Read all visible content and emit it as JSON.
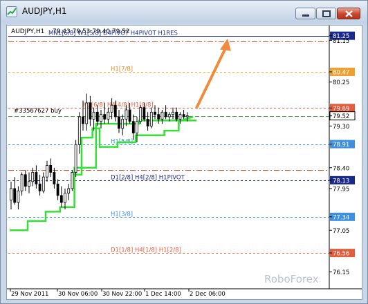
{
  "window": {
    "title": "AUDJPY,H1",
    "buttons": [
      "minimize",
      "maximize",
      "close"
    ]
  },
  "chart_header": {
    "symbol": "AUDJPY,H1",
    "ohlc": "79.43 79.53 79.40 79.52"
  },
  "watermark": "RoboForex",
  "levels": [
    {
      "label": "MN1[6/8] W1[5/8] D4PIVOT H4PIVOT H1RES",
      "price": 81.25,
      "color": "#1a2a8c",
      "style": "solid",
      "label_color": "#1a2a8c"
    },
    {
      "label": "",
      "price": 81.13,
      "color": "#d9442b",
      "style": "dashdot",
      "label_color": ""
    },
    {
      "label": "H1[7/8]",
      "price": 80.47,
      "color": "#f0a030",
      "style": "dash",
      "label_color": "#e08a20"
    },
    {
      "label": "H1[6/8] H4[4/8] H1[8/8]",
      "price": 79.69,
      "color": "#e35c3e",
      "style": "dash",
      "label_color": "#e35c3e"
    },
    {
      "label": "H1[5/8]",
      "price": 78.91,
      "color": "#3d8fe0",
      "style": "dash",
      "label_color": "#3d8fe0"
    },
    {
      "label": "",
      "price": 78.35,
      "color": "#d9442b",
      "style": "dashdot",
      "label_color": ""
    },
    {
      "label": "D1[2/8] H4[2/8] H1PIVOT",
      "price": 78.13,
      "color": "#1a2a8c",
      "style": "dash",
      "label_color": "#1a2a8c"
    },
    {
      "label": "H1[3/8]",
      "price": 77.34,
      "color": "#3d8fe0",
      "style": "dash",
      "label_color": "#3d8fe0"
    },
    {
      "label": "D1[1/8] H4[1/8] H1[2/8]",
      "price": 76.56,
      "color": "#e35c3e",
      "style": "dash",
      "label_color": "#e35c3e"
    }
  ],
  "order": {
    "label": "#33567627 buy",
    "price": 79.52,
    "color": "#3c9a3c"
  },
  "current_price": {
    "value": 79.52,
    "color": "#000000"
  },
  "price_labels": [
    {
      "text": "81.25",
      "price": 81.25,
      "bg": "#1a2a8c",
      "fg": "#ffffff"
    },
    {
      "text": "81.15",
      "price": 81.15,
      "bg": "",
      "fg": "#000000"
    },
    {
      "text": "80.47",
      "price": 80.47,
      "bg": "#f0a030",
      "fg": "#ffffff"
    },
    {
      "text": "80.25",
      "price": 80.25,
      "bg": "",
      "fg": "#000000"
    },
    {
      "text": "79.69",
      "price": 79.69,
      "bg": "#e35c3e",
      "fg": "#ffffff"
    },
    {
      "text": "79.52",
      "price": 79.52,
      "bg": "#ffffff",
      "fg": "#000000"
    },
    {
      "text": "79.30",
      "price": 79.3,
      "bg": "",
      "fg": "#000000"
    },
    {
      "text": "78.91",
      "price": 78.91,
      "bg": "#3d8fe0",
      "fg": "#ffffff"
    },
    {
      "text": "78.40",
      "price": 78.4,
      "bg": "",
      "fg": "#000000"
    },
    {
      "text": "78.13",
      "price": 78.13,
      "bg": "#1a2a8c",
      "fg": "#ffffff"
    },
    {
      "text": "77.95",
      "price": 77.95,
      "bg": "",
      "fg": "#000000"
    },
    {
      "text": "77.34",
      "price": 77.34,
      "bg": "#3d8fe0",
      "fg": "#ffffff"
    },
    {
      "text": "77.05",
      "price": 77.05,
      "bg": "",
      "fg": "#000000"
    },
    {
      "text": "76.56",
      "price": 76.56,
      "bg": "#e35c3e",
      "fg": "#ffffff"
    },
    {
      "text": "76.15",
      "price": 76.15,
      "bg": "",
      "fg": "#000000"
    }
  ],
  "time_labels": [
    "29 Nov 2011",
    "30 Nov 06:00",
    "30 Nov 22:00",
    "1 Dec 14:00",
    "2 Dec 06:00"
  ],
  "chart_data": {
    "type": "candlestick",
    "ylim": [
      75.95,
      81.35
    ],
    "candles": [
      [
        77.7,
        78.1,
        77.5,
        77.95
      ],
      [
        77.95,
        78.2,
        77.6,
        77.65
      ],
      [
        77.65,
        78.0,
        77.5,
        77.9
      ],
      [
        77.9,
        78.3,
        77.8,
        78.25
      ],
      [
        78.25,
        78.35,
        77.9,
        78.0
      ],
      [
        78.0,
        78.3,
        77.85,
        78.1
      ],
      [
        78.1,
        78.4,
        78.0,
        78.3
      ],
      [
        78.3,
        78.45,
        77.95,
        78.05
      ],
      [
        78.05,
        78.25,
        77.8,
        77.9
      ],
      [
        77.9,
        78.3,
        77.85,
        78.2
      ],
      [
        78.2,
        78.55,
        78.1,
        78.45
      ],
      [
        78.45,
        78.6,
        78.2,
        78.3
      ],
      [
        78.3,
        78.4,
        77.95,
        78.05
      ],
      [
        78.05,
        78.15,
        77.7,
        77.8
      ],
      [
        77.8,
        78.0,
        77.55,
        77.65
      ],
      [
        77.65,
        77.95,
        77.5,
        77.85
      ],
      [
        77.85,
        78.05,
        77.7,
        77.95
      ],
      [
        77.95,
        78.35,
        77.9,
        78.3
      ],
      [
        78.3,
        79.0,
        78.2,
        78.9
      ],
      [
        78.9,
        79.6,
        78.7,
        79.5
      ],
      [
        79.5,
        79.85,
        79.2,
        79.35
      ],
      [
        79.35,
        80.0,
        79.2,
        79.8
      ],
      [
        79.8,
        79.95,
        79.3,
        79.45
      ],
      [
        79.45,
        79.7,
        79.2,
        79.6
      ],
      [
        79.6,
        79.75,
        79.3,
        79.4
      ],
      [
        79.4,
        79.65,
        79.25,
        79.55
      ],
      [
        79.55,
        79.8,
        79.35,
        79.45
      ],
      [
        79.45,
        79.7,
        79.35,
        79.6
      ],
      [
        79.6,
        79.9,
        79.45,
        79.75
      ],
      [
        79.75,
        79.85,
        79.4,
        79.5
      ],
      [
        79.5,
        79.65,
        79.15,
        79.25
      ],
      [
        79.25,
        79.55,
        79.1,
        79.45
      ],
      [
        79.45,
        79.75,
        79.3,
        79.65
      ],
      [
        79.65,
        79.8,
        79.35,
        79.4
      ],
      [
        79.4,
        79.55,
        79.0,
        79.15
      ],
      [
        79.15,
        79.5,
        78.95,
        79.4
      ],
      [
        79.4,
        79.75,
        79.35,
        79.7
      ],
      [
        79.7,
        79.8,
        79.4,
        79.45
      ],
      [
        79.45,
        79.6,
        79.2,
        79.3
      ],
      [
        79.3,
        79.7,
        79.25,
        79.6
      ],
      [
        79.6,
        79.75,
        79.45,
        79.55
      ],
      [
        79.55,
        79.7,
        79.35,
        79.45
      ],
      [
        79.45,
        79.65,
        79.35,
        79.6
      ],
      [
        79.6,
        79.75,
        79.45,
        79.5
      ],
      [
        79.5,
        79.6,
        79.4,
        79.55
      ],
      [
        79.55,
        79.7,
        79.45,
        79.6
      ],
      [
        79.6,
        79.7,
        79.4,
        79.45
      ],
      [
        79.45,
        79.6,
        79.35,
        79.55
      ],
      [
        79.55,
        79.65,
        79.45,
        79.5
      ],
      [
        79.5,
        79.6,
        79.4,
        79.52
      ]
    ],
    "stop_upper": [
      [
        0,
        77.05
      ],
      [
        5,
        77.05
      ],
      [
        5,
        77.25
      ],
      [
        10,
        77.25
      ],
      [
        10,
        77.45
      ],
      [
        14,
        77.45
      ],
      [
        14,
        77.55
      ],
      [
        18,
        77.55
      ],
      [
        18,
        78.4
      ],
      [
        24,
        78.4
      ],
      [
        24,
        79.35
      ],
      [
        36,
        79.35
      ],
      [
        36,
        79.42
      ],
      [
        52,
        79.42
      ]
    ],
    "stop_lower": [
      [
        18,
        78.25
      ],
      [
        20,
        78.25
      ],
      [
        20,
        79.05
      ],
      [
        23,
        79.05
      ],
      [
        23,
        79.25
      ],
      [
        25,
        79.25
      ],
      [
        25,
        78.85
      ],
      [
        30,
        78.85
      ],
      [
        30,
        78.95
      ],
      [
        35,
        78.95
      ],
      [
        35,
        79.1
      ],
      [
        43,
        79.1
      ],
      [
        43,
        79.2
      ],
      [
        47,
        79.2
      ],
      [
        47,
        79.4
      ],
      [
        51,
        79.5
      ]
    ],
    "arrow": {
      "from": [
        52,
        79.7
      ],
      "to": [
        60,
        81.1
      ]
    }
  }
}
